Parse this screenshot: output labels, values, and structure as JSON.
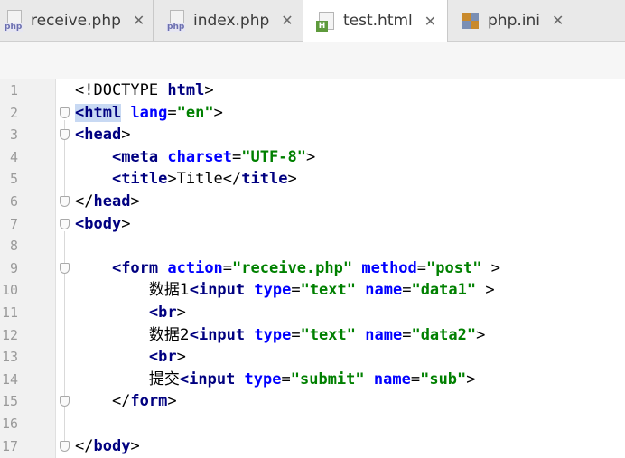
{
  "tabs": [
    {
      "label": "receive.php",
      "icon": "php-file-icon",
      "icon_text": "php"
    },
    {
      "label": "index.php",
      "icon": "php-file-icon",
      "icon_text": "php"
    },
    {
      "label": "test.html",
      "icon": "html-file-icon",
      "icon_text": "H",
      "active": true
    },
    {
      "label": "php.ini",
      "icon": "ini-file-icon"
    }
  ],
  "close_glyph": "✕",
  "editor": {
    "lines": [
      {
        "num": "1",
        "parts": [
          [
            "txt",
            "<!DOCTYPE "
          ],
          [
            "tag",
            "html"
          ],
          [
            "txt",
            ">"
          ]
        ]
      },
      {
        "num": "2",
        "parts": [
          [
            "tag",
            "<html",
            "hl"
          ],
          [
            "txt",
            " "
          ],
          [
            "attr",
            "lang"
          ],
          [
            "txt",
            "="
          ],
          [
            "val",
            "\"en\""
          ],
          [
            "txt",
            ">"
          ]
        ]
      },
      {
        "num": "3",
        "parts": [
          [
            "tag",
            "<head"
          ],
          [
            "txt",
            ">"
          ]
        ]
      },
      {
        "num": "4",
        "parts": [
          [
            "txt",
            "    "
          ],
          [
            "tag",
            "<meta "
          ],
          [
            "attr",
            "charset"
          ],
          [
            "txt",
            "="
          ],
          [
            "val",
            "\"UTF-8\""
          ],
          [
            "txt",
            ">"
          ]
        ]
      },
      {
        "num": "5",
        "parts": [
          [
            "txt",
            "    "
          ],
          [
            "tag",
            "<title"
          ],
          [
            "txt",
            ">Title</"
          ],
          [
            "tag",
            "title"
          ],
          [
            "txt",
            ">"
          ]
        ]
      },
      {
        "num": "6",
        "parts": [
          [
            "txt",
            "</"
          ],
          [
            "tag",
            "head"
          ],
          [
            "txt",
            ">"
          ]
        ]
      },
      {
        "num": "7",
        "parts": [
          [
            "tag",
            "<body"
          ],
          [
            "txt",
            ">"
          ]
        ]
      },
      {
        "num": "8",
        "parts": []
      },
      {
        "num": "9",
        "parts": [
          [
            "txt",
            "    "
          ],
          [
            "tag",
            "<form "
          ],
          [
            "attr",
            "action"
          ],
          [
            "txt",
            "="
          ],
          [
            "val",
            "\"receive.php\""
          ],
          [
            "txt",
            " "
          ],
          [
            "attr",
            "method"
          ],
          [
            "txt",
            "="
          ],
          [
            "val",
            "\"post\""
          ],
          [
            "txt",
            " >"
          ]
        ]
      },
      {
        "num": "10",
        "parts": [
          [
            "txt",
            "        "
          ],
          [
            "cn",
            "数据1"
          ],
          [
            "tag",
            "<input "
          ],
          [
            "attr",
            "type"
          ],
          [
            "txt",
            "="
          ],
          [
            "val",
            "\"text\""
          ],
          [
            "txt",
            " "
          ],
          [
            "attr",
            "name"
          ],
          [
            "txt",
            "="
          ],
          [
            "val",
            "\"data1\""
          ],
          [
            "txt",
            " >"
          ]
        ]
      },
      {
        "num": "11",
        "parts": [
          [
            "txt",
            "        "
          ],
          [
            "tag",
            "<br"
          ],
          [
            "txt",
            ">"
          ]
        ]
      },
      {
        "num": "12",
        "parts": [
          [
            "txt",
            "        "
          ],
          [
            "cn",
            "数据2"
          ],
          [
            "tag",
            "<input "
          ],
          [
            "attr",
            "type"
          ],
          [
            "txt",
            "="
          ],
          [
            "val",
            "\"text\""
          ],
          [
            "txt",
            " "
          ],
          [
            "attr",
            "name"
          ],
          [
            "txt",
            "="
          ],
          [
            "val",
            "\"data2\""
          ],
          [
            "txt",
            ">"
          ]
        ]
      },
      {
        "num": "13",
        "parts": [
          [
            "txt",
            "        "
          ],
          [
            "tag",
            "<br"
          ],
          [
            "txt",
            ">"
          ]
        ]
      },
      {
        "num": "14",
        "parts": [
          [
            "txt",
            "        "
          ],
          [
            "cn",
            "提交"
          ],
          [
            "tag",
            "<input "
          ],
          [
            "attr",
            "type"
          ],
          [
            "txt",
            "="
          ],
          [
            "val",
            "\"submit\""
          ],
          [
            "txt",
            " "
          ],
          [
            "attr",
            "name"
          ],
          [
            "txt",
            "="
          ],
          [
            "val",
            "\"sub\""
          ],
          [
            "txt",
            ">"
          ]
        ]
      },
      {
        "num": "15",
        "parts": [
          [
            "txt",
            "    </"
          ],
          [
            "tag",
            "form"
          ],
          [
            "txt",
            ">"
          ]
        ]
      },
      {
        "num": "16",
        "parts": []
      },
      {
        "num": "17",
        "parts": [
          [
            "txt",
            "</"
          ],
          [
            "tag",
            "body"
          ],
          [
            "txt",
            ">"
          ]
        ]
      }
    ],
    "fold_markers": [
      "2",
      "3",
      "6",
      "7",
      "9",
      "15",
      "17"
    ]
  }
}
